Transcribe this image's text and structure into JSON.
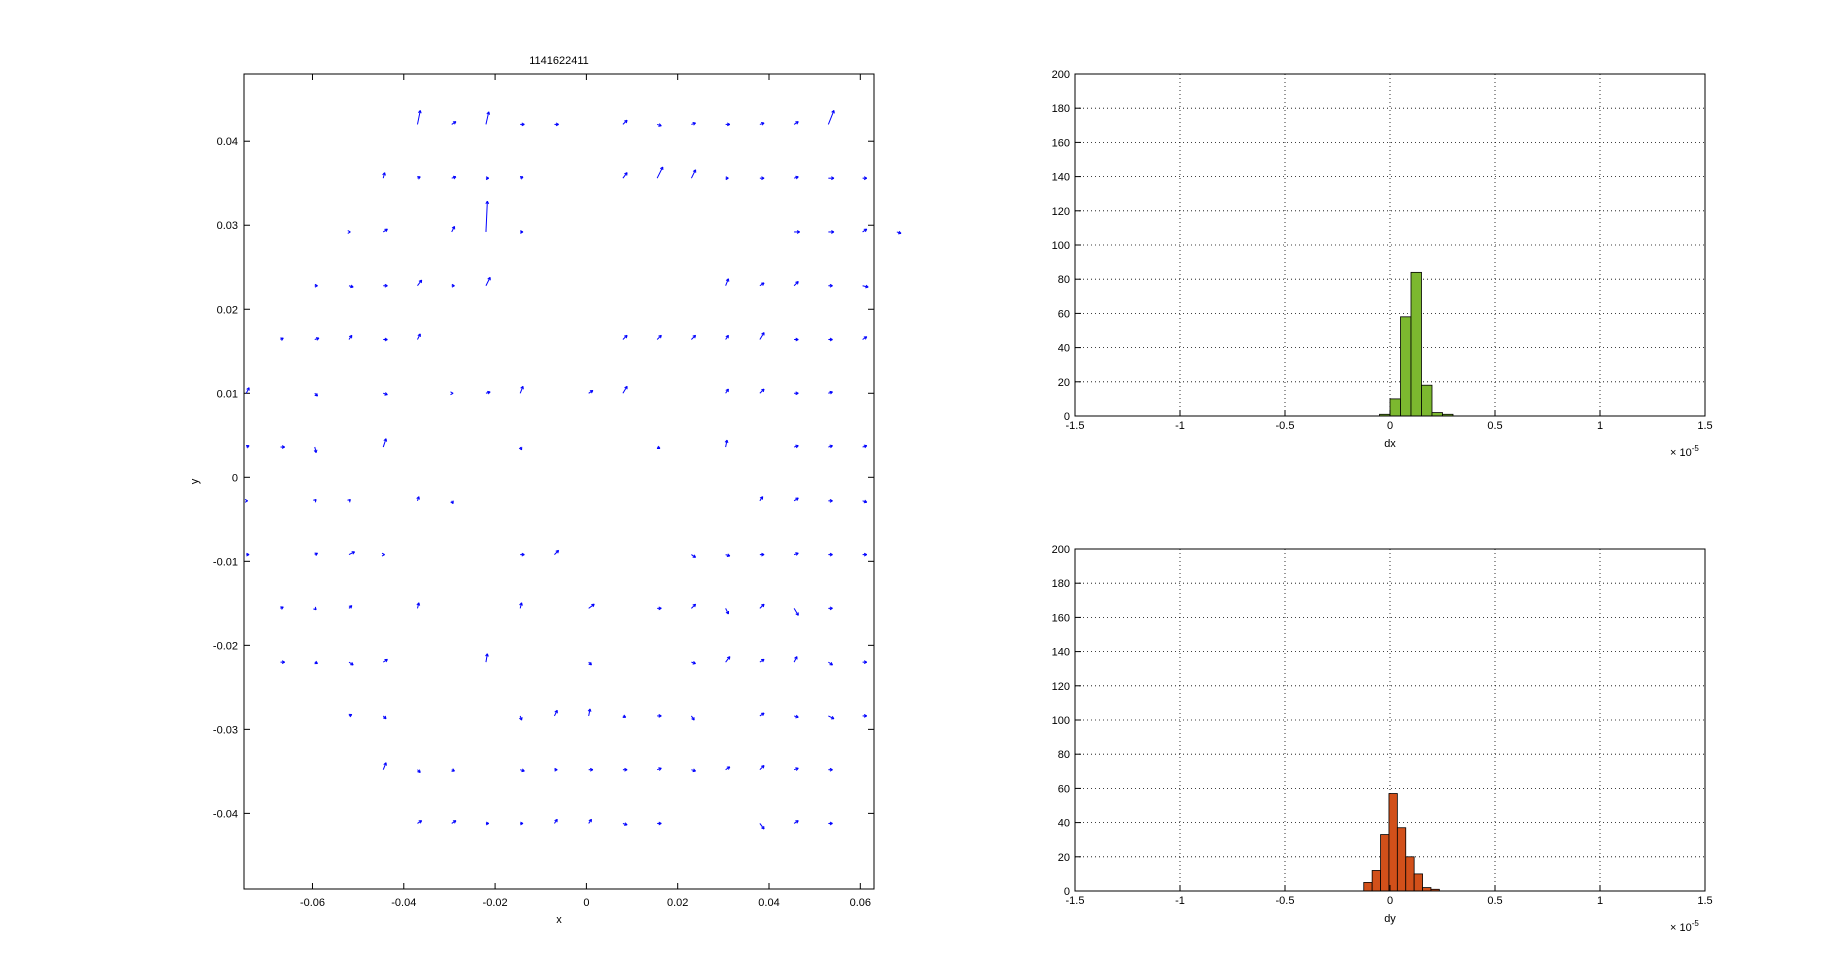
{
  "figure": {
    "background": "#ffffff"
  },
  "chart_data": [
    {
      "type": "quiver",
      "title": "1141622411",
      "xlabel": "x",
      "ylabel": "y",
      "xlim": [
        -0.075,
        0.063
      ],
      "ylim": [
        -0.049,
        0.048
      ],
      "xticks": [
        -0.06,
        -0.04,
        -0.02,
        0,
        0.02,
        0.04,
        0.06
      ],
      "xtick_labels": [
        "-0.06",
        "-0.04",
        "-0.02",
        "0",
        "0.02",
        "0.04",
        "0.06"
      ],
      "yticks": [
        -0.04,
        -0.03,
        -0.02,
        -0.01,
        0,
        0.01,
        0.02,
        0.03,
        0.04
      ],
      "ytick_labels": [
        "-0.04",
        "-0.03",
        "-0.02",
        "-0.01",
        "0",
        "0.01",
        "0.02",
        "0.03",
        "0.04"
      ],
      "grid": false,
      "color": "#0000ff",
      "grid_x0": -0.0745,
      "grid_dx": 0.0075,
      "grid_y0": 0.042,
      "grid_dy": -0.0064,
      "arrows": [
        [
          5,
          0,
          0.2,
          1
        ],
        [
          6,
          0,
          0.3,
          0.2
        ],
        [
          7,
          0,
          0.2,
          0.9
        ],
        [
          8,
          0,
          0.3,
          0
        ],
        [
          9,
          0,
          0.3,
          0
        ],
        [
          11,
          0,
          0.3,
          0.3
        ],
        [
          12,
          0,
          0.3,
          -0.1
        ],
        [
          13,
          0,
          0.3,
          0.1
        ],
        [
          14,
          0,
          0.3,
          0
        ],
        [
          15,
          0,
          0.3,
          0.1
        ],
        [
          16,
          0,
          0.3,
          0.2
        ],
        [
          17,
          0,
          0.4,
          1
        ],
        [
          4,
          1,
          0.1,
          0.4
        ],
        [
          5,
          1,
          0.2,
          0.1
        ],
        [
          6,
          1,
          0.3,
          0.1
        ],
        [
          7,
          1,
          0.2,
          0
        ],
        [
          8,
          1,
          0.2,
          0.1
        ],
        [
          11,
          1,
          0.3,
          0.4
        ],
        [
          12,
          1,
          0.4,
          0.8
        ],
        [
          13,
          1,
          0.3,
          0.6
        ],
        [
          14,
          1,
          0.2,
          0
        ],
        [
          15,
          1,
          0.3,
          0
        ],
        [
          16,
          1,
          0.3,
          0.1
        ],
        [
          17,
          1,
          0.4,
          0
        ],
        [
          18,
          1,
          0.3,
          0
        ],
        [
          3,
          2,
          0.1,
          0
        ],
        [
          4,
          2,
          0.3,
          0.2
        ],
        [
          6,
          2,
          0.2,
          0.4
        ],
        [
          7,
          2,
          0.1,
          2.2
        ],
        [
          8,
          2,
          0.2,
          0
        ],
        [
          16,
          2,
          0.4,
          0
        ],
        [
          17,
          2,
          0.4,
          0
        ],
        [
          18,
          2,
          0.3,
          0.2
        ],
        [
          19,
          2,
          0.3,
          -0.1
        ],
        [
          2,
          3,
          0.2,
          0
        ],
        [
          3,
          3,
          0.3,
          -0.1
        ],
        [
          4,
          3,
          0.3,
          0
        ],
        [
          5,
          3,
          0.3,
          0.4
        ],
        [
          6,
          3,
          0.2,
          0
        ],
        [
          7,
          3,
          0.3,
          0.6
        ],
        [
          14,
          3,
          0.2,
          0.5
        ],
        [
          15,
          3,
          0.3,
          0.2
        ],
        [
          16,
          3,
          0.3,
          0.3
        ],
        [
          17,
          3,
          0.3,
          0
        ],
        [
          18,
          3,
          0.4,
          -0.1
        ],
        [
          1,
          4,
          0.2,
          0.1
        ],
        [
          2,
          4,
          0.3,
          0.1
        ],
        [
          3,
          4,
          0.2,
          0.3
        ],
        [
          4,
          4,
          0.3,
          0
        ],
        [
          5,
          4,
          0.2,
          0.4
        ],
        [
          11,
          4,
          0.3,
          0.3
        ],
        [
          12,
          4,
          0.3,
          0.3
        ],
        [
          13,
          4,
          0.3,
          0.3
        ],
        [
          14,
          4,
          0.2,
          0.3
        ],
        [
          15,
          4,
          0.3,
          0.5
        ],
        [
          16,
          4,
          0.3,
          0
        ],
        [
          17,
          4,
          0.3,
          0
        ],
        [
          18,
          4,
          0.3,
          0.2
        ],
        [
          0,
          5,
          0.2,
          0.4
        ],
        [
          2,
          5,
          0.2,
          -0.2
        ],
        [
          4,
          5,
          0.3,
          -0.1
        ],
        [
          6,
          5,
          0.1,
          0
        ],
        [
          7,
          5,
          0.3,
          0.1
        ],
        [
          8,
          5,
          0.2,
          0.5
        ],
        [
          10,
          5,
          0.3,
          0.2
        ],
        [
          11,
          5,
          0.3,
          0.5
        ],
        [
          14,
          5,
          0.2,
          0.3
        ],
        [
          15,
          5,
          0.3,
          0.3
        ],
        [
          16,
          5,
          0.3,
          0
        ],
        [
          17,
          5,
          0.3,
          0.1
        ],
        [
          0,
          6,
          0.2,
          0.1
        ],
        [
          1,
          6,
          0.3,
          0
        ],
        [
          2,
          6,
          0.1,
          -0.4
        ],
        [
          4,
          6,
          0.2,
          0.6
        ],
        [
          8,
          6,
          0.1,
          -0.2
        ],
        [
          12,
          6,
          0.2,
          -0.1
        ],
        [
          14,
          6,
          0.1,
          0.5
        ],
        [
          16,
          6,
          0.3,
          0.1
        ],
        [
          17,
          6,
          0.3,
          0.1
        ],
        [
          18,
          6,
          0.3,
          0.1
        ],
        [
          0,
          7,
          0.1,
          0
        ],
        [
          2,
          7,
          0.1,
          0.1
        ],
        [
          3,
          7,
          0.1,
          0.1
        ],
        [
          5,
          7,
          0.1,
          0.3
        ],
        [
          6,
          7,
          0.1,
          -0.2
        ],
        [
          15,
          7,
          0.2,
          0.3
        ],
        [
          16,
          7,
          0.3,
          0.2
        ],
        [
          17,
          7,
          0.3,
          0
        ],
        [
          18,
          7,
          0.3,
          -0.1
        ],
        [
          0,
          8,
          0.2,
          0
        ],
        [
          2,
          8,
          0.2,
          0.1
        ],
        [
          3,
          8,
          0.4,
          0.2
        ],
        [
          4,
          8,
          0.1,
          0
        ],
        [
          8,
          8,
          0.3,
          0
        ],
        [
          9,
          8,
          0.3,
          0.3
        ],
        [
          13,
          8,
          0.3,
          -0.2
        ],
        [
          14,
          8,
          0.3,
          -0.1
        ],
        [
          15,
          8,
          0.3,
          0
        ],
        [
          16,
          8,
          0.3,
          0.1
        ],
        [
          17,
          8,
          0.3,
          0
        ],
        [
          18,
          8,
          0.3,
          0
        ],
        [
          1,
          9,
          0.2,
          0.1
        ],
        [
          2,
          9,
          0.1,
          -0.1
        ],
        [
          3,
          9,
          0.2,
          0.2
        ],
        [
          5,
          9,
          0.1,
          0.4
        ],
        [
          8,
          9,
          0.1,
          0.4
        ],
        [
          10,
          9,
          0.4,
          0.3
        ],
        [
          12,
          9,
          0.3,
          0
        ],
        [
          13,
          9,
          0.3,
          0.3
        ],
        [
          14,
          9,
          0.2,
          -0.4
        ],
        [
          15,
          9,
          0.3,
          0.3
        ],
        [
          16,
          9,
          0.3,
          -0.5
        ],
        [
          17,
          9,
          0.3,
          0
        ],
        [
          1,
          10,
          0.3,
          0
        ],
        [
          2,
          10,
          0.2,
          -0.1
        ],
        [
          3,
          10,
          0.3,
          -0.2
        ],
        [
          4,
          10,
          0.3,
          0.2
        ],
        [
          7,
          10,
          0.1,
          0.6
        ],
        [
          10,
          10,
          0.2,
          -0.2
        ],
        [
          13,
          10,
          0.3,
          -0.1
        ],
        [
          14,
          10,
          0.3,
          0.4
        ],
        [
          15,
          10,
          0.3,
          0.2
        ],
        [
          16,
          10,
          0.2,
          0.4
        ],
        [
          17,
          10,
          0.3,
          -0.2
        ],
        [
          18,
          10,
          0.3,
          0
        ],
        [
          3,
          11,
          0.2,
          0.1
        ],
        [
          4,
          11,
          0.2,
          -0.2
        ],
        [
          8,
          11,
          0.1,
          -0.3
        ],
        [
          9,
          11,
          0.2,
          0.4
        ],
        [
          10,
          11,
          0.1,
          0.5
        ],
        [
          11,
          11,
          0.2,
          -0.1
        ],
        [
          12,
          11,
          0.3,
          0
        ],
        [
          13,
          11,
          0.2,
          -0.3
        ],
        [
          15,
          11,
          0.3,
          0.2
        ],
        [
          16,
          11,
          0.3,
          -0.1
        ],
        [
          17,
          11,
          0.4,
          -0.2
        ],
        [
          18,
          11,
          0.3,
          0
        ],
        [
          4,
          12,
          0.2,
          0.5
        ],
        [
          5,
          12,
          0.2,
          -0.2
        ],
        [
          6,
          12,
          0.2,
          -0.1
        ],
        [
          8,
          12,
          0.3,
          -0.1
        ],
        [
          9,
          12,
          0.2,
          0
        ],
        [
          10,
          12,
          0.3,
          0
        ],
        [
          11,
          12,
          0.3,
          0
        ],
        [
          12,
          12,
          0.3,
          0.1
        ],
        [
          13,
          12,
          0.3,
          -0.1
        ],
        [
          14,
          12,
          0.3,
          0.2
        ],
        [
          15,
          12,
          0.3,
          0.3
        ],
        [
          16,
          12,
          0.3,
          0.1
        ],
        [
          17,
          12,
          0.3,
          0
        ],
        [
          5,
          13,
          0.3,
          0.2
        ],
        [
          6,
          13,
          0.3,
          0.2
        ],
        [
          7,
          13,
          0.2,
          0
        ],
        [
          8,
          13,
          0.2,
          0
        ],
        [
          9,
          13,
          0.2,
          0.3
        ],
        [
          10,
          13,
          0.2,
          0.3
        ],
        [
          11,
          13,
          0.3,
          -0.1
        ],
        [
          12,
          13,
          0.3,
          0
        ],
        [
          15,
          13,
          0.3,
          -0.4
        ],
        [
          16,
          13,
          0.3,
          0.2
        ],
        [
          17,
          13,
          0.3,
          0
        ]
      ]
    },
    {
      "type": "histogram",
      "xlabel": "dx",
      "x_exponent": "× 10",
      "x_exponent_power": "-5",
      "xlim": [
        -1.5,
        1.5
      ],
      "ylim": [
        0,
        200
      ],
      "xticks": [
        -1.5,
        -1,
        -0.5,
        0,
        0.5,
        1,
        1.5
      ],
      "xtick_labels": [
        "-1.5",
        "-1",
        "-0.5",
        "0",
        "0.5",
        "1",
        "1.5"
      ],
      "yticks": [
        0,
        20,
        40,
        60,
        80,
        100,
        120,
        140,
        160,
        180,
        200
      ],
      "ytick_labels": [
        "0",
        "20",
        "40",
        "60",
        "80",
        "100",
        "120",
        "140",
        "160",
        "180",
        "200"
      ],
      "grid": true,
      "color": "#7cb82f",
      "bin_edges": [
        -0.05,
        0,
        0.05,
        0.1,
        0.15,
        0.2,
        0.25,
        0.3
      ],
      "counts": [
        1,
        10,
        58,
        84,
        18,
        2,
        1
      ]
    },
    {
      "type": "histogram",
      "xlabel": "dy",
      "x_exponent": "× 10",
      "x_exponent_power": "-5",
      "xlim": [
        -1.5,
        1.5
      ],
      "ylim": [
        0,
        200
      ],
      "xticks": [
        -1.5,
        -1,
        -0.5,
        0,
        0.5,
        1,
        1.5
      ],
      "xtick_labels": [
        "-1.5",
        "-1",
        "-0.5",
        "0",
        "0.5",
        "1",
        "1.5"
      ],
      "yticks": [
        0,
        20,
        40,
        60,
        80,
        100,
        120,
        140,
        160,
        180,
        200
      ],
      "ytick_labels": [
        "0",
        "20",
        "40",
        "60",
        "80",
        "100",
        "120",
        "140",
        "160",
        "180",
        "200"
      ],
      "grid": true,
      "color": "#d2501a",
      "bin_edges": [
        -0.125,
        -0.085,
        -0.045,
        -0.005,
        0.035,
        0.075,
        0.115,
        0.155,
        0.195,
        0.235
      ],
      "counts": [
        5,
        12,
        33,
        57,
        37,
        20,
        10,
        2,
        1
      ]
    }
  ]
}
